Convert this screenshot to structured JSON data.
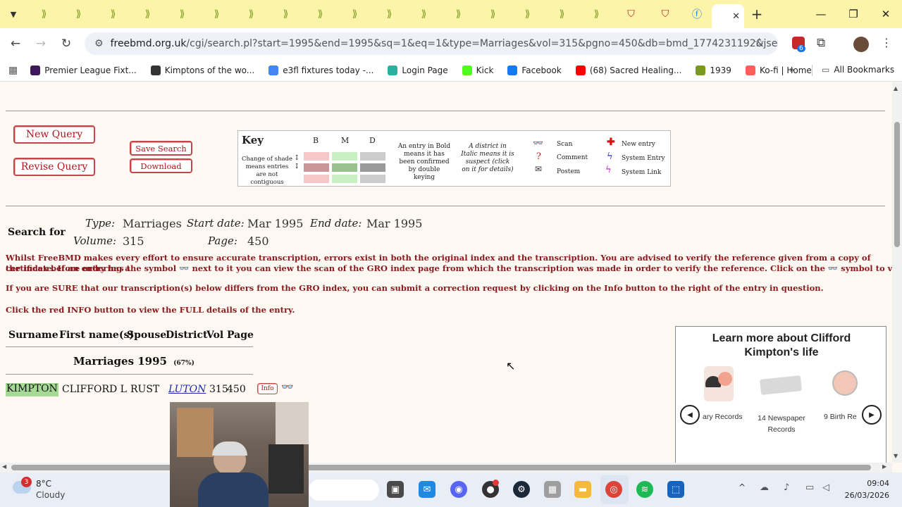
{
  "browser": {
    "url_host": "freebmd.org.uk",
    "url_path": "/cgi/search.pl?start=1995&end=1995&sq=1&eq=1&type=Marriages&vol=315&pgno=450&db=bmd_1774231192&jsexec=1&...",
    "extensions_badge": "6",
    "bookmarks": [
      {
        "label": "Premier League Fixt...",
        "icon": "lion-icon",
        "color": "#3d195b"
      },
      {
        "label": "Kimptons of the wo...",
        "icon": "globe-icon",
        "color": "#333333"
      },
      {
        "label": "e3fl fixtures today -...",
        "icon": "google-icon",
        "color": "#4285f4"
      },
      {
        "label": "Login Page",
        "icon": "login-icon",
        "color": "#2bb0a0"
      },
      {
        "label": "Kick",
        "icon": "kick-icon",
        "color": "#53fc18"
      },
      {
        "label": "Facebook",
        "icon": "facebook-icon",
        "color": "#1877f2"
      },
      {
        "label": "(68) Sacred Healing...",
        "icon": "youtube-icon",
        "color": "#ff0000"
      },
      {
        "label": "1939",
        "icon": "leaf-icon",
        "color": "#7a9a1c"
      },
      {
        "label": "Ko-fi | Home",
        "icon": "kofi-icon",
        "color": "#ff5e5b"
      }
    ],
    "all_bookmarks": "All Bookmarks"
  },
  "buttons": {
    "new_query": "New Query",
    "revise_query": "Revise Query",
    "save_search": "Save Search",
    "download": "Download"
  },
  "key": {
    "title": "Key",
    "col_b": "B",
    "col_m": "M",
    "col_d": "D",
    "shade_note": "Change of shade means entries are not contiguous",
    "bold_note": "An entry in Bold means it has been confirmed by double keying",
    "italic_note": "A district in Italic means it is suspect (click on it for details)",
    "scan": "Scan",
    "comment": "Comment",
    "postem": "Postem",
    "new_entry": "New entry",
    "system_entry": "System Entry",
    "system_link": "System Link"
  },
  "search": {
    "heading": "Search for",
    "type_label": "Type:",
    "type_value": "Marriages",
    "start_label": "Start date:",
    "start_value": "Mar 1995",
    "end_label": "End date:",
    "end_value": "Mar 1995",
    "volume_label": "Volume:",
    "volume_value": "315",
    "page_label": "Page:",
    "page_value": "450"
  },
  "notes": {
    "disclaimer_1": "Whilst FreeBMD makes every effort to ensure accurate transcription, errors exist in both the original index and the transcription. You are advised to verify the reference given from a copy of the index before ordering a",
    "disclaimer_2a": "certificate. If an entry has the symbol",
    "disclaimer_2b": "next to it you can view the scan of the GRO index page from which the transcription was made in order to verify the reference. Click on the",
    "disclaimer_2c": "symbol to view the scan.",
    "sure": "If you are SURE that our transcription(s) below differs from the GRO index, you can submit a correction request by clicking on the Info button to the right of the entry in question.",
    "info": "Click the red INFO button to view the FULL details of the entry."
  },
  "results": {
    "headers": [
      "Surname",
      "First name(s)",
      "Spouse",
      "District",
      "Vol",
      "Page"
    ],
    "section": "Marriages 1995",
    "section_pct": "(67%)",
    "row": {
      "surname": "KIMPTON",
      "first": "CLIFFORD L",
      "spouse": "RUST",
      "district": "LUTON",
      "vol": "315",
      "page": "450",
      "info": "Info"
    }
  },
  "sidepanel": {
    "title": "Learn more about Clifford Kimpton's life",
    "items": [
      {
        "label": "ary Records",
        "icon": "helmet-icon"
      },
      {
        "label": "14 Newspaper Records",
        "icon": "newspaper-icon"
      },
      {
        "label": "9 Birth Re",
        "icon": "stopwatch-icon"
      }
    ]
  },
  "taskbar": {
    "weather_temp": "8°C",
    "weather_desc": "Cloudy",
    "weather_badge": "3",
    "time": "09:04",
    "date": "26/03/2026"
  }
}
